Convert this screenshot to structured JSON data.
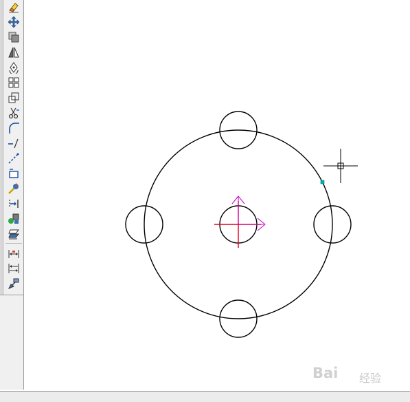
{
  "toolbar": {
    "tools": [
      {
        "name": "erase-tool",
        "icon": "eraser-icon"
      },
      {
        "name": "move-tool",
        "icon": "move-icon"
      },
      {
        "name": "copy-tool",
        "icon": "copy-icon"
      },
      {
        "name": "mirror-tool",
        "icon": "mirror-icon"
      },
      {
        "name": "rotate-tool",
        "icon": "rotate-icon"
      },
      {
        "name": "array-tool",
        "icon": "array-icon"
      },
      {
        "name": "scale-tool",
        "icon": "scale-icon"
      },
      {
        "name": "trim-tool",
        "icon": "scissors-icon"
      },
      {
        "name": "fillet-tool",
        "icon": "fillet-icon"
      },
      {
        "name": "break-tool",
        "icon": "break-icon"
      },
      {
        "name": "extend-tool",
        "icon": "extend-icon"
      },
      {
        "name": "stretch-tool",
        "icon": "stretch-icon"
      },
      {
        "name": "explode-tool",
        "icon": "explode-icon"
      },
      {
        "name": "align-tool",
        "icon": "align-icon"
      },
      {
        "name": "block-tool",
        "icon": "block-icon"
      },
      {
        "name": "layer-tool",
        "icon": "layer-icon"
      },
      {
        "name": "dimension-tool",
        "icon": "dimension-icon"
      },
      {
        "name": "continue-dimension-tool",
        "icon": "continue-dimension-icon"
      },
      {
        "name": "format-painter-tool",
        "icon": "paintbrush-icon"
      }
    ]
  },
  "drawing": {
    "colors": {
      "stroke": "#000000",
      "axis_x": "#e0001b",
      "axis_y": "#e0001b",
      "ucs_arrow": "#c000c0",
      "grip": "#00b0b0",
      "cursor": "#000000"
    }
  },
  "watermark": {
    "text": "Bai",
    "sub": "经验"
  }
}
